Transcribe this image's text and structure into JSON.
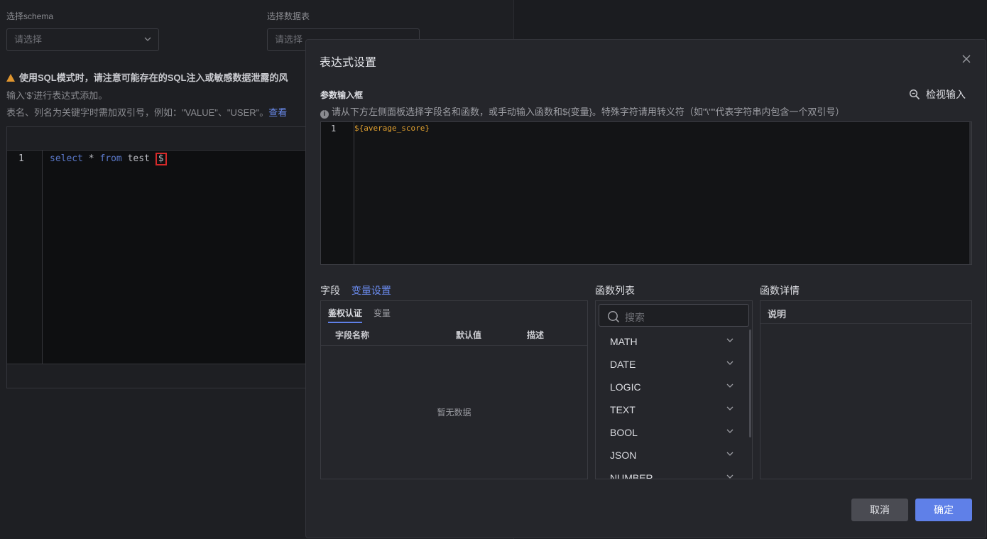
{
  "background": {
    "schema_label": "选择schema",
    "schema_placeholder": "请选择",
    "table_label": "选择数据表",
    "table_placeholder": "请选择",
    "warning": "使用SQL模式时，请注意可能存在的SQL注入或敏感数据泄露的风",
    "hint1": "输入'$'进行表达式添加。",
    "hint2": "表名、列名为关键字时需加双引号，例如：\"VALUE\"、\"USER\"。",
    "hint2_link": "查看",
    "sql_line_no": "1",
    "sql_kw1": "select",
    "sql_star": " * ",
    "sql_kw2": "from",
    "sql_table": " test ",
    "sql_dollar": "$"
  },
  "modal": {
    "title": "表达式设置",
    "param_title": "参数输入框",
    "inspect_label": "检视输入",
    "info_text": "请从下方左侧面板选择字段名和函数，或手动输入函数和${变量}。特殊字符请用转义符（如\"\\\"\"代表字符串内包含一个双引号）",
    "editor_line_no": "1",
    "editor_code": "${average_score}",
    "field_tab": "字段",
    "variable_tab": "变量设置",
    "sub_tab_auth": "鉴权认证",
    "sub_tab_var": "变量",
    "col_name": "字段名称",
    "col_default": "默认值",
    "col_desc": "描述",
    "empty": "暂无数据",
    "fn_list_title": "函数列表",
    "search_placeholder": "搜索",
    "functions": [
      "MATH",
      "DATE",
      "LOGIC",
      "TEXT",
      "BOOL",
      "JSON",
      "NUMBER"
    ],
    "fn_detail_title": "函数详情",
    "detail_header": "说明",
    "cancel": "取消",
    "confirm": "确定"
  },
  "colors": {
    "accent": "#5f80e8",
    "warning": "#e0962f",
    "code_var": "#e2a12f",
    "sql_keyword": "#5a78c9",
    "highlight_box": "#d62a2a"
  }
}
